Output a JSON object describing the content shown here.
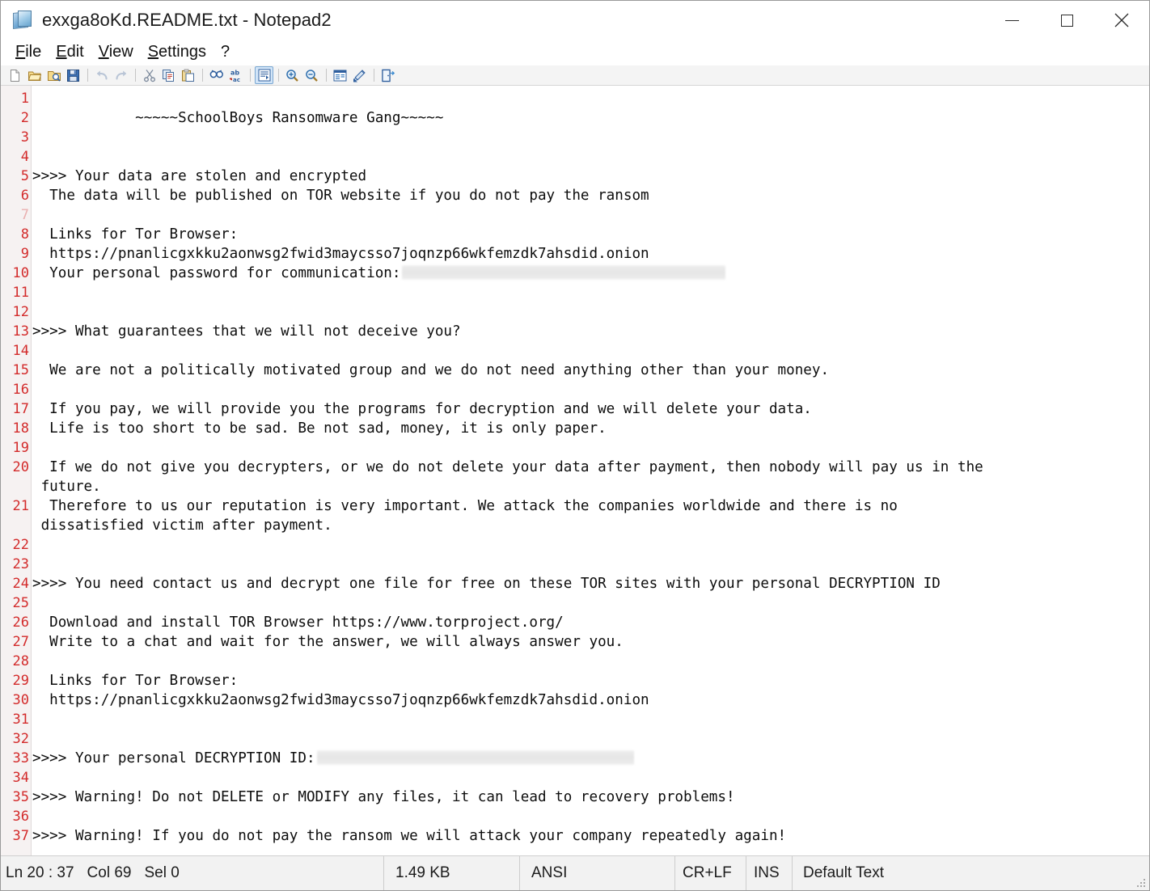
{
  "window": {
    "title": "exxga8oKd.README.txt - Notepad2",
    "icon": "notepad2-document-icon",
    "controls": {
      "minimize": "Minimize",
      "maximize": "Maximize",
      "close": "Close"
    }
  },
  "menubar": {
    "items": [
      {
        "label": "File",
        "accel": "F"
      },
      {
        "label": "Edit",
        "accel": "E"
      },
      {
        "label": "View",
        "accel": "V"
      },
      {
        "label": "Settings",
        "accel": "S"
      },
      {
        "label": "?",
        "accel": ""
      }
    ]
  },
  "toolbar": {
    "buttons": [
      {
        "name": "new-file-icon",
        "tip": "New"
      },
      {
        "name": "open-file-icon",
        "tip": "Open"
      },
      {
        "name": "browse-file-icon",
        "tip": "Browse"
      },
      {
        "name": "save-file-icon",
        "tip": "Save"
      },
      {
        "name": "undo-icon",
        "tip": "Undo"
      },
      {
        "name": "redo-icon",
        "tip": "Redo"
      },
      {
        "name": "cut-icon",
        "tip": "Cut"
      },
      {
        "name": "copy-icon",
        "tip": "Copy"
      },
      {
        "name": "paste-icon",
        "tip": "Paste"
      },
      {
        "name": "find-icon",
        "tip": "Find"
      },
      {
        "name": "replace-icon",
        "tip": "Replace"
      },
      {
        "name": "word-wrap-icon",
        "tip": "Word Wrap",
        "active": true
      },
      {
        "name": "zoom-in-icon",
        "tip": "Zoom In"
      },
      {
        "name": "zoom-out-icon",
        "tip": "Zoom Out"
      },
      {
        "name": "scheme-icon",
        "tip": "Scheme"
      },
      {
        "name": "scheme-options-icon",
        "tip": "Scheme Options"
      },
      {
        "name": "exit-icon",
        "tip": "Exit"
      }
    ]
  },
  "editor": {
    "lines": [
      {
        "n": 1,
        "text": ""
      },
      {
        "n": 2,
        "text": "            ~~~~~SchoolBoys Ransomware Gang~~~~~"
      },
      {
        "n": 3,
        "text": ""
      },
      {
        "n": 4,
        "text": ""
      },
      {
        "n": 5,
        "text": ">>>> Your data are stolen and encrypted"
      },
      {
        "n": 6,
        "text": "  The data will be published on TOR website if you do not pay the ransom"
      },
      {
        "n": 7,
        "text": ""
      },
      {
        "n": 8,
        "text": "  Links for Tor Browser:"
      },
      {
        "n": 9,
        "text": "  https://pnanlicgxkku2aonwsg2fwid3maycsso7joqnzp66wkfemzdk7ahsdid.onion"
      },
      {
        "n": 10,
        "text": "  Your personal password for communication:",
        "redact": 400
      },
      {
        "n": 11,
        "text": ""
      },
      {
        "n": 12,
        "text": ""
      },
      {
        "n": 13,
        "text": ">>>> What guarantees that we will not deceive you?"
      },
      {
        "n": 14,
        "text": ""
      },
      {
        "n": 15,
        "text": "  We are not a politically motivated group and we do not need anything other than your money."
      },
      {
        "n": 16,
        "text": ""
      },
      {
        "n": 17,
        "text": "  If you pay, we will provide you the programs for decryption and we will delete your data."
      },
      {
        "n": 18,
        "text": "  Life is too short to be sad. Be not sad, money, it is only paper."
      },
      {
        "n": 19,
        "text": ""
      },
      {
        "n": 20,
        "text": "  If we do not give you decrypters, or we do not delete your data after payment, then nobody will pay us in the"
      },
      {
        "n": null,
        "text": " future."
      },
      {
        "n": 21,
        "text": "  Therefore to us our reputation is very important. We attack the companies worldwide and there is no"
      },
      {
        "n": null,
        "text": " dissatisfied victim after payment."
      },
      {
        "n": 22,
        "text": ""
      },
      {
        "n": 23,
        "text": ""
      },
      {
        "n": 24,
        "text": ">>>> You need contact us and decrypt one file for free on these TOR sites with your personal DECRYPTION ID"
      },
      {
        "n": 25,
        "text": ""
      },
      {
        "n": 26,
        "text": "  Download and install TOR Browser https://www.torproject.org/"
      },
      {
        "n": 27,
        "text": "  Write to a chat and wait for the answer, we will always answer you."
      },
      {
        "n": 28,
        "text": ""
      },
      {
        "n": 29,
        "text": "  Links for Tor Browser:"
      },
      {
        "n": 30,
        "text": "  https://pnanlicgxkku2aonwsg2fwid3maycsso7joqnzp66wkfemzdk7ahsdid.onion"
      },
      {
        "n": 31,
        "text": ""
      },
      {
        "n": 32,
        "text": ""
      },
      {
        "n": 33,
        "text": ">>>> Your personal DECRYPTION ID:",
        "redact": 392
      },
      {
        "n": 34,
        "text": ""
      },
      {
        "n": 35,
        "text": ">>>> Warning! Do not DELETE or MODIFY any files, it can lead to recovery problems!"
      },
      {
        "n": 36,
        "text": ""
      },
      {
        "n": 37,
        "text": ">>>> Warning! If you do not pay the ransom we will attack your company repeatedly again!"
      }
    ]
  },
  "statusbar": {
    "line_col": "Ln 20 : 37",
    "col": "Col 69",
    "sel": "Sel 0",
    "size": "1.49 KB",
    "encoding": "ANSI",
    "eol": "CR+LF",
    "insert_mode": "INS",
    "scheme": "Default Text"
  },
  "colors": {
    "line_number": "#d32b2b",
    "gutter_bg": "#f6f2f2",
    "text": "#0d0d0d",
    "toolbar_bg": "#f4f4f4",
    "statusbar_bg": "#f2f2f2",
    "redaction": "#e6e6e6"
  }
}
